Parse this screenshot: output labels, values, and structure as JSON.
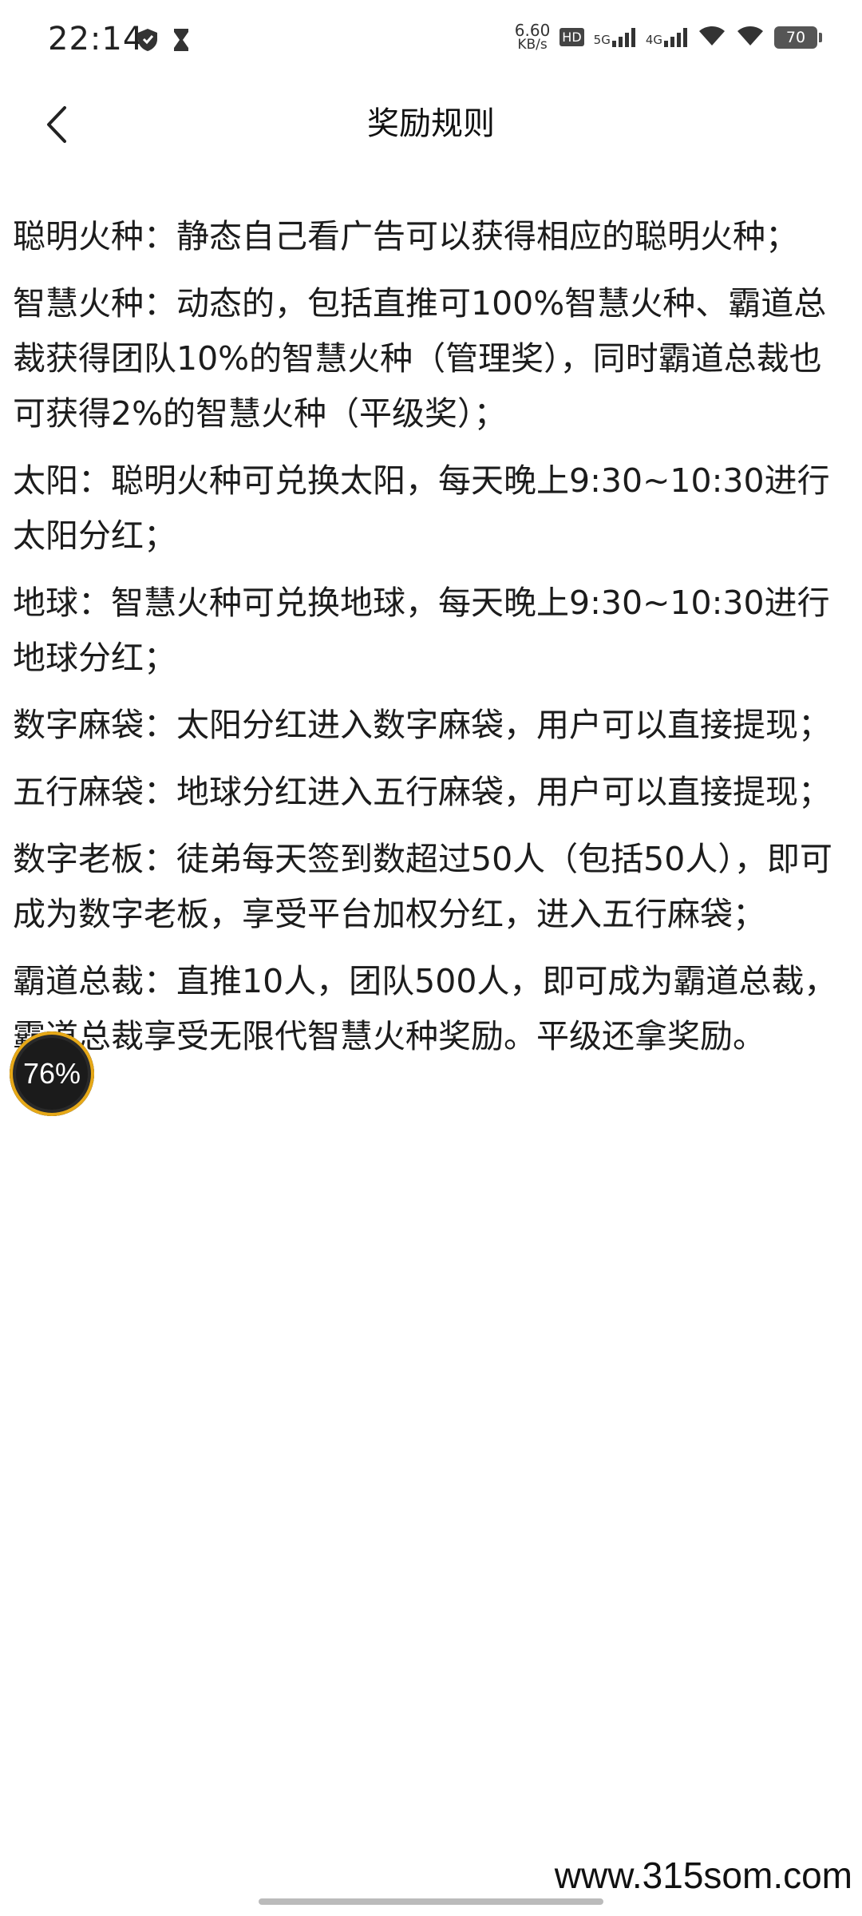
{
  "status_bar": {
    "time": "22:14",
    "net_speed_value": "6.60",
    "net_speed_unit": "KB/s",
    "hd_label": "HD",
    "sim1_label": "5G",
    "sim2_label": "4G",
    "battery": "70",
    "icons": [
      "shield-icon",
      "hourglass-icon",
      "hd-icon",
      "signal-icon",
      "signal-icon",
      "wifi-icon",
      "wifi-icon",
      "battery-icon"
    ]
  },
  "header": {
    "title": "奖励规则",
    "back_icon": "chevron-left-icon"
  },
  "rules": [
    {
      "name": "聪明火种",
      "desc": "静态自己看广告可以获得相应的聪明火种；"
    },
    {
      "name": "智慧火种",
      "desc": "动态的，包括直推可100%智慧火种、霸道总裁获得团队10%的智慧火种（管理奖），同时霸道总裁也可获得2%的智慧火种（平级奖）；"
    },
    {
      "name": "太阳",
      "desc": "聪明火种可兑换太阳，每天晚上9:30~10:30进行太阳分红；"
    },
    {
      "name": "地球",
      "desc": "智慧火种可兑换地球，每天晚上9:30~10:30进行地球分红；"
    },
    {
      "name": "数字麻袋",
      "desc": "太阳分红进入数字麻袋，用户可以直接提现；"
    },
    {
      "name": "五行麻袋",
      "desc": "地球分红进入五行麻袋，用户可以直接提现；"
    },
    {
      "name": "数字老板",
      "desc": "徒弟每天签到数超过50人（包括50人），即可成为数字老板，享受平台加权分红，进入五行麻袋；"
    },
    {
      "name": "霸道总裁",
      "desc": "直推10人，团队500人，即可成为霸道总裁，霸道总裁享受无限代智慧火种奖励。平级还拿奖励。"
    }
  ],
  "separator": "：",
  "float_badge": "76%",
  "watermark": "www.315som.com"
}
